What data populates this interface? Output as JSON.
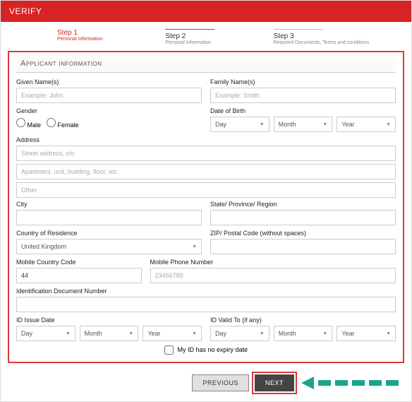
{
  "header": {
    "title": "VERIFY"
  },
  "steps": [
    {
      "title": "Step 1",
      "sub": "Personal Information",
      "active": true
    },
    {
      "title": "Step 2",
      "sub": "Personal Information",
      "active": false
    },
    {
      "title": "Step 3",
      "sub": "Required Documents, Terms and conditions",
      "active": false
    }
  ],
  "section_title": "Applicant information",
  "labels": {
    "given": "Given Name(s)",
    "family": "Family Name(s)",
    "gender": "Gender",
    "male": "Male",
    "female": "Female",
    "dob": "Date of Birth",
    "address": "Address",
    "city": "City",
    "state": "State/ Province/ Region",
    "country": "Country of Residence",
    "zip": "ZIP/ Postal Code (without spaces)",
    "mcc": "Mobile Country Code",
    "mphone": "Mobile Phone Number",
    "idnum": "Identification Document Number",
    "issue": "ID Issue Date",
    "valid": "ID Valid To (if any)",
    "noexpiry": "My ID has no expiry date"
  },
  "placeholders": {
    "given": "Example: John",
    "family": "Example: Smith",
    "addr1": "Street address, c/o",
    "addr2": "Apartment, unit, building, floor, etc",
    "addr3": "Other",
    "mphone": "23456789"
  },
  "selects": {
    "day": "Day",
    "month": "Month",
    "year": "Year",
    "country_value": "United Kingdom"
  },
  "values": {
    "mcc": "44"
  },
  "buttons": {
    "prev": "PREVIOUS",
    "next": "NEXT"
  }
}
